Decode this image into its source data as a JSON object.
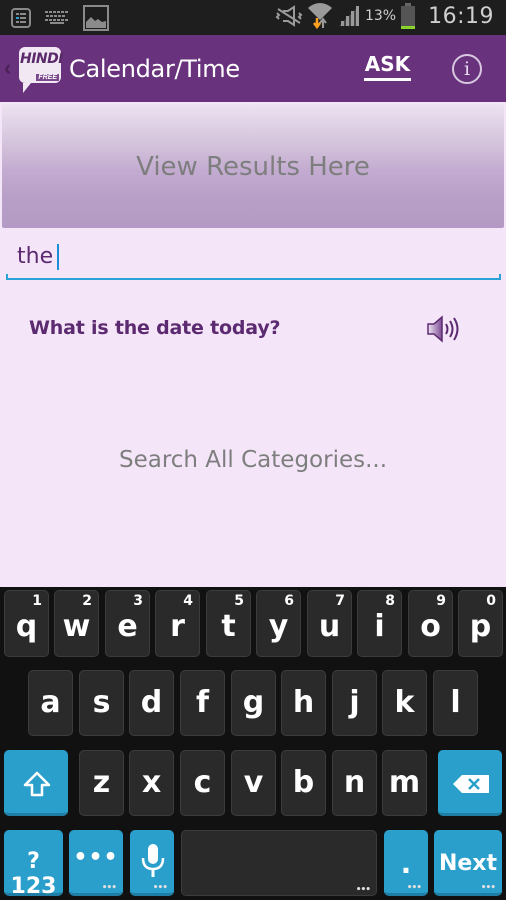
{
  "status_bar": {
    "left_icons": [
      "notification-list-icon",
      "keyboard-icon",
      "image-icon"
    ],
    "right_icons": [
      "mute-vibrate-icon",
      "wifi-icon",
      "signal-icon",
      "battery-icon"
    ],
    "battery_percent": "13%",
    "time": "16:19",
    "battery_color": "#8bd42b"
  },
  "app_bar": {
    "back_glyph": "‹",
    "logo_text": "HINDI",
    "logo_badge": "FREE",
    "title": "Calendar/Time",
    "ask_label": "ASK",
    "info_glyph": "i",
    "color": "#68327c"
  },
  "results_panel": {
    "placeholder": "View Results Here"
  },
  "search": {
    "value": "the",
    "accent": "#2aa2d6"
  },
  "results": [
    {
      "text": "What is the date today?",
      "icon": "speaker-icon"
    }
  ],
  "search_all_label": "Search All Categories...",
  "keyboard": {
    "row1": [
      {
        "key": "q",
        "sup": "1"
      },
      {
        "key": "w",
        "sup": "2"
      },
      {
        "key": "e",
        "sup": "3"
      },
      {
        "key": "r",
        "sup": "4"
      },
      {
        "key": "t",
        "sup": "5"
      },
      {
        "key": "y",
        "sup": "6"
      },
      {
        "key": "u",
        "sup": "7"
      },
      {
        "key": "i",
        "sup": "8"
      },
      {
        "key": "o",
        "sup": "9"
      },
      {
        "key": "p",
        "sup": "0"
      }
    ],
    "row2": [
      "a",
      "s",
      "d",
      "f",
      "g",
      "h",
      "j",
      "k",
      "l"
    ],
    "row3": [
      "z",
      "x",
      "c",
      "v",
      "b",
      "n",
      "m"
    ],
    "symbols_label": "?123",
    "more_label": "•••",
    "period_label": ".",
    "next_label": "Next",
    "more_indicator": "•••"
  }
}
